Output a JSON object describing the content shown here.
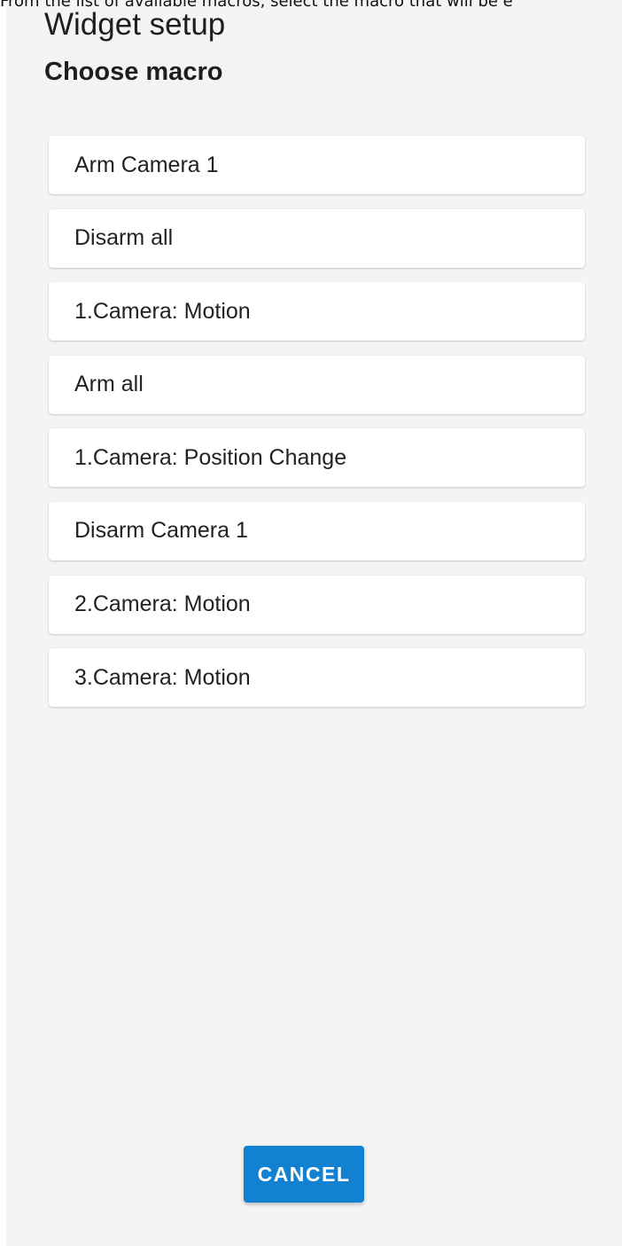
{
  "instruction": "From the list of available macros, select the macro that will be e",
  "header": {
    "title": "Widget setup",
    "subtitle": "Choose macro"
  },
  "macros": [
    {
      "label": "Arm Camera 1"
    },
    {
      "label": "Disarm all"
    },
    {
      "label": "1.Camera: Motion"
    },
    {
      "label": "Arm all"
    },
    {
      "label": "1.Camera: Position Change"
    },
    {
      "label": "Disarm Camera 1"
    },
    {
      "label": "2.Camera: Motion"
    },
    {
      "label": "3.Camera: Motion"
    }
  ],
  "actions": {
    "cancel_label": "CANCEL"
  },
  "colors": {
    "background": "#f4f4f4",
    "card": "#ffffff",
    "accent": "#1281d1"
  }
}
